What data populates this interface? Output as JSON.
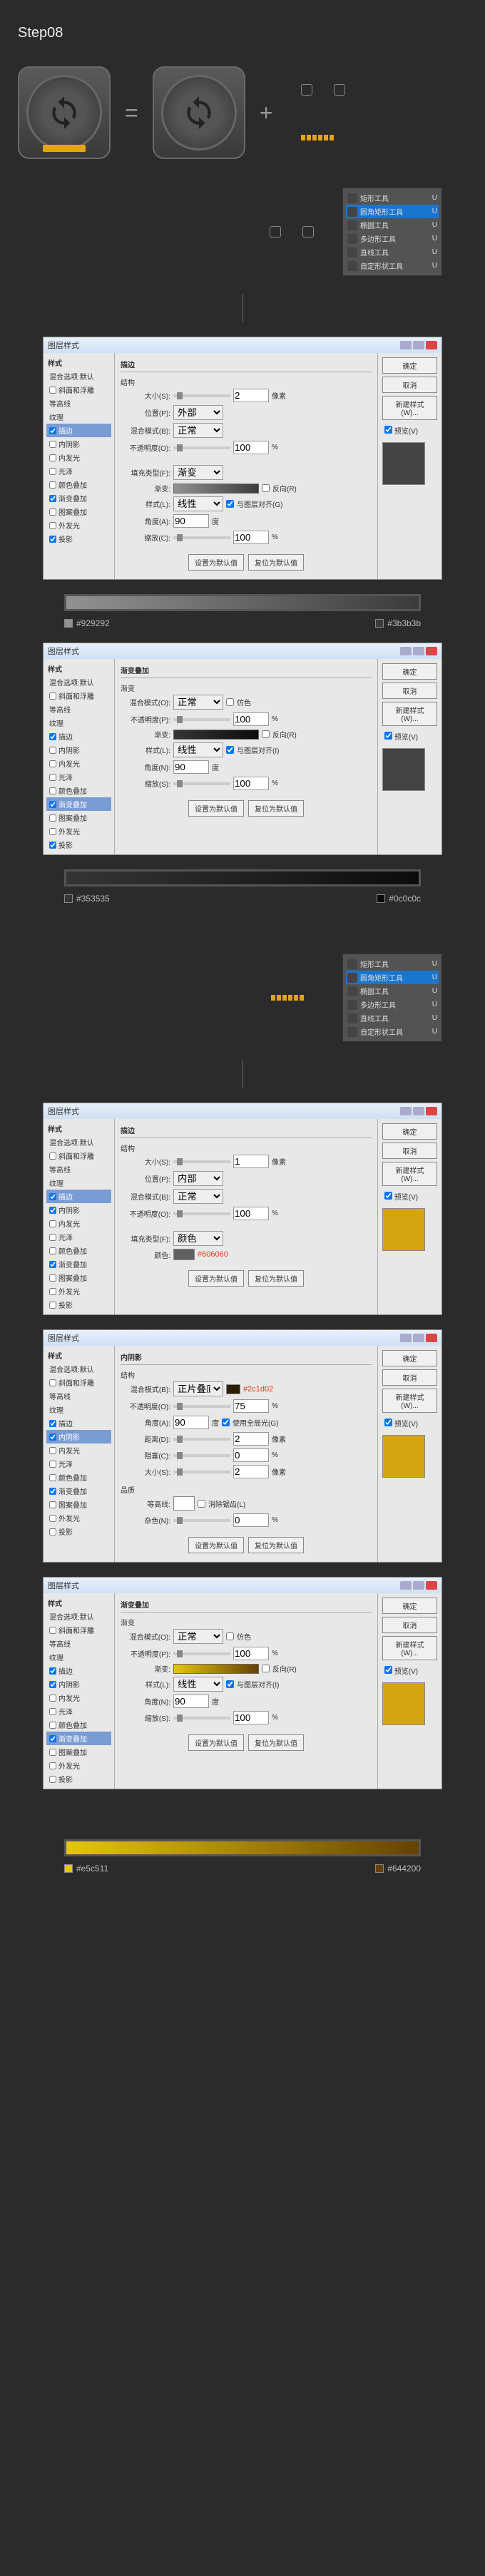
{
  "step_title": "Step08",
  "equation": {
    "equals": "=",
    "plus": "+"
  },
  "tool_panel": {
    "items": [
      {
        "label": "矩形工具",
        "key": "U"
      },
      {
        "label": "圆角矩形工具",
        "key": "U"
      },
      {
        "label": "椭圆工具",
        "key": "U"
      },
      {
        "label": "多边形工具",
        "key": "U"
      },
      {
        "label": "直线工具",
        "key": "U"
      },
      {
        "label": "自定形状工具",
        "key": "U"
      }
    ],
    "active_index_a": 1,
    "active_index_b": 1
  },
  "dialog1": {
    "title": "图层样式",
    "left_title": "样式",
    "styles": [
      "混合选项:默认",
      "斜面和浮雕",
      "等高线",
      "纹理",
      "描边",
      "内阴影",
      "内发光",
      "光泽",
      "颜色叠加",
      "渐变叠加",
      "图案叠加",
      "外发光",
      "投影"
    ],
    "checked": [
      false,
      false,
      false,
      false,
      true,
      false,
      false,
      false,
      false,
      true,
      false,
      false,
      true
    ],
    "selected": 4,
    "section": "描边",
    "subsection": "结构",
    "size_label": "大小(S):",
    "size_val": "2",
    "size_unit": "像素",
    "pos_label": "位置(P):",
    "pos_val": "外部",
    "blend_label": "混合模式(B):",
    "blend_val": "正常",
    "opacity_label": "不透明度(O):",
    "opacity_val": "100",
    "opacity_unit": "%",
    "filltype_label": "填充类型(F):",
    "filltype_val": "渐变",
    "grad_label": "渐变:",
    "reverse_label": "反向(R)",
    "style_label": "样式(L):",
    "style_val": "线性",
    "align_label": "与图层对齐(G)",
    "angle_label": "角度(A):",
    "angle_val": "90",
    "angle_unit": "度",
    "scale_label": "缩放(C):",
    "scale_val": "100",
    "scale_unit": "%",
    "reset_default": "设置为默认值",
    "reset_to_default": "复位为默认值",
    "ok": "确定",
    "cancel": "取消",
    "new_style": "新建样式(W)...",
    "preview": "预览(V)"
  },
  "grad1": {
    "left": "#929292",
    "right": "#3b3b3b"
  },
  "dialog2": {
    "title": "图层样式",
    "left_title": "样式",
    "styles": [
      "混合选项:默认",
      "斜面和浮雕",
      "等高线",
      "纹理",
      "描边",
      "内阴影",
      "内发光",
      "光泽",
      "颜色叠加",
      "渐变叠加",
      "图案叠加",
      "外发光",
      "投影"
    ],
    "checked": [
      false,
      false,
      false,
      false,
      true,
      false,
      false,
      false,
      false,
      true,
      false,
      false,
      true
    ],
    "selected": 9,
    "section": "渐变叠加",
    "subsection": "渐变",
    "blend_label": "混合模式(O):",
    "blend_val": "正常",
    "dither_label": "仿色",
    "opacity_label": "不透明度(P):",
    "opacity_val": "100",
    "opacity_unit": "%",
    "grad_label": "渐变:",
    "reverse_label": "反向(R)",
    "style_label": "样式(L):",
    "style_val": "线性",
    "align_label": "与图层对齐(I)",
    "angle_label": "角度(N):",
    "angle_val": "90",
    "angle_unit": "度",
    "scale_label": "缩放(S):",
    "scale_val": "100",
    "scale_unit": "%",
    "reset_default": "设置为默认值",
    "reset_to_default": "复位为默认值",
    "ok": "确定",
    "cancel": "取消",
    "new_style": "新建样式(W)...",
    "preview": "预览(V)"
  },
  "grad2": {
    "left": "#353535",
    "right": "#0c0c0c"
  },
  "dialog3": {
    "title": "图层样式",
    "left_title": "样式",
    "styles": [
      "混合选项:默认",
      "斜面和浮雕",
      "等高线",
      "纹理",
      "描边",
      "内阴影",
      "内发光",
      "光泽",
      "颜色叠加",
      "渐变叠加",
      "图案叠加",
      "外发光",
      "投影"
    ],
    "checked": [
      false,
      false,
      false,
      false,
      true,
      true,
      false,
      false,
      false,
      true,
      false,
      false,
      false
    ],
    "selected": 4,
    "section": "描边",
    "subsection": "结构",
    "size_label": "大小(S):",
    "size_val": "1",
    "size_unit": "像素",
    "pos_label": "位置(P):",
    "pos_val": "内部",
    "blend_label": "混合模式(B):",
    "blend_val": "正常",
    "opacity_label": "不透明度(O):",
    "opacity_val": "100",
    "opacity_unit": "%",
    "filltype_label": "填充类型(F):",
    "filltype_val": "颜色",
    "color_label": "颜色:",
    "color_val": "#606060",
    "reset_default": "设置为默认值",
    "reset_to_default": "复位为默认值",
    "ok": "确定",
    "cancel": "取消",
    "new_style": "新建样式(W)...",
    "preview": "预览(V)"
  },
  "dialog4": {
    "title": "图层样式",
    "left_title": "样式",
    "styles": [
      "混合选项:默认",
      "斜面和浮雕",
      "等高线",
      "纹理",
      "描边",
      "内阴影",
      "内发光",
      "光泽",
      "颜色叠加",
      "渐变叠加",
      "图案叠加",
      "外发光",
      "投影"
    ],
    "checked": [
      false,
      false,
      false,
      false,
      true,
      true,
      false,
      false,
      false,
      true,
      false,
      false,
      false
    ],
    "selected": 5,
    "section": "内阴影",
    "subsection": "结构",
    "blend_label": "混合模式(B):",
    "blend_val": "正片叠底",
    "blend_color": "#2c1d02",
    "opacity_label": "不透明度(O):",
    "opacity_val": "75",
    "opacity_unit": "%",
    "angle_label": "角度(A):",
    "angle_val": "90",
    "angle_unit": "度",
    "global_label": "使用全局光(G)",
    "distance_label": "距离(D):",
    "distance_val": "2",
    "distance_unit": "像素",
    "choke_label": "阻塞(C):",
    "choke_val": "0",
    "choke_unit": "%",
    "size_label": "大小(S):",
    "size_val": "2",
    "size_unit": "像素",
    "quality_section": "品质",
    "contour_label": "等高线:",
    "antialias_label": "消除锯齿(L)",
    "noise_label": "杂色(N):",
    "noise_val": "0",
    "noise_unit": "%",
    "reset_default": "设置为默认值",
    "reset_to_default": "复位为默认值",
    "ok": "确定",
    "cancel": "取消",
    "new_style": "新建样式(W)...",
    "preview": "预览(V)"
  },
  "dialog5": {
    "title": "图层样式",
    "left_title": "样式",
    "styles": [
      "混合选项:默认",
      "斜面和浮雕",
      "等高线",
      "纹理",
      "描边",
      "内阴影",
      "内发光",
      "光泽",
      "颜色叠加",
      "渐变叠加",
      "图案叠加",
      "外发光",
      "投影"
    ],
    "checked": [
      false,
      false,
      false,
      false,
      true,
      true,
      false,
      false,
      false,
      true,
      false,
      false,
      false
    ],
    "selected": 9,
    "section": "渐变叠加",
    "subsection": "渐变",
    "blend_label": "混合模式(O):",
    "blend_val": "正常",
    "dither_label": "仿色",
    "opacity_label": "不透明度(P):",
    "opacity_val": "100",
    "opacity_unit": "%",
    "grad_label": "渐变:",
    "reverse_label": "反向(R)",
    "style_label": "样式(L):",
    "style_val": "线性",
    "align_label": "与图层对齐(I)",
    "angle_label": "角度(N):",
    "angle_val": "90",
    "angle_unit": "度",
    "scale_label": "缩放(S):",
    "scale_val": "100",
    "scale_unit": "%",
    "reset_default": "设置为默认值",
    "reset_to_default": "复位为默认值",
    "ok": "确定",
    "cancel": "取消",
    "new_style": "新建样式(W)...",
    "preview": "预览(V)"
  },
  "grad3": {
    "left": "#e5c511",
    "right": "#644200"
  }
}
